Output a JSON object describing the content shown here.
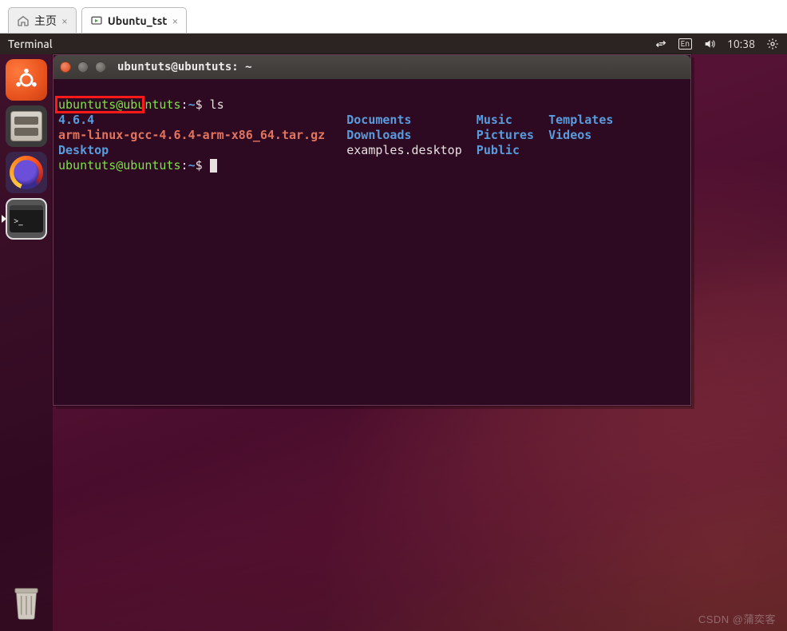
{
  "host_tabs": {
    "tab0": {
      "label": "主页"
    },
    "tab1": {
      "label": "Ubuntu_tst"
    }
  },
  "menubar": {
    "app": "Terminal",
    "lang": "En",
    "time": "10:38"
  },
  "launcher": {
    "items": [
      "ubuntu-dash",
      "files",
      "firefox",
      "terminal"
    ],
    "trash": "trash"
  },
  "terminal": {
    "title": "ubuntuts@ubuntuts: ~",
    "prompt_user": "ubuntuts@ubuntuts",
    "prompt_path": "~",
    "prompt_sym": "$",
    "cmd1": "ls",
    "ls": {
      "col0_0": "4.6.4",
      "col0_1": "arm-linux-gcc-4.6.4-arm-x86_64.tar.gz",
      "col0_2": "Desktop",
      "col1_0": "Documents",
      "col1_1": "Downloads",
      "col1_2": "examples.desktop",
      "col2_0": "Music",
      "col2_1": "Pictures",
      "col2_2": "Public",
      "col3_0": "Templates",
      "col3_1": "Videos"
    }
  },
  "watermark": "CSDN @蒲奕客"
}
